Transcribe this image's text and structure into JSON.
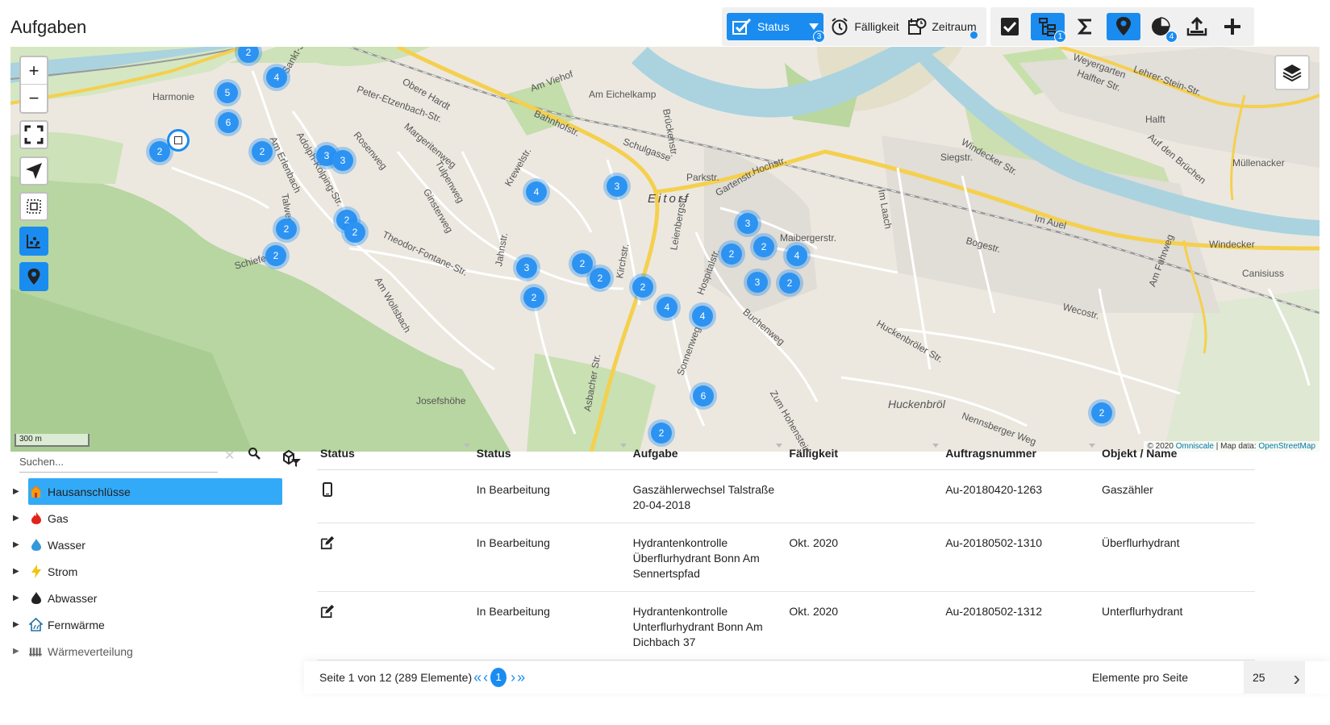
{
  "title": "Aufgaben",
  "toolbar": {
    "status_label": "Status",
    "status_badge": "3",
    "faelligkeit_label": "Fälligkeit",
    "zeitraum_label": "Zeitraum",
    "hierarchy_badge": "1",
    "chart_badge": "4"
  },
  "map": {
    "zoom_in": "+",
    "zoom_out": "−",
    "scale": "300 m",
    "attribution_prefix": "© 2020",
    "attribution_omniscale": "Omniscale",
    "attribution_sep": "| Map data:",
    "attribution_osm": "OpenStreetMap",
    "clusters": [
      "2",
      "5",
      "4",
      "6",
      "2",
      "2",
      "3",
      "3",
      "4",
      "3",
      "2",
      "2",
      "2",
      "2",
      "3",
      "2",
      "2",
      "2",
      "2",
      "4",
      "3",
      "2",
      "4",
      "2",
      "3",
      "2",
      "4",
      "6",
      "2",
      "2"
    ],
    "labels": [
      "Harmonie",
      "Eitorf",
      "Huckenbröl",
      "Josefshöhe",
      "Bahnhofstr.",
      "Siegstr.",
      "Windecker Str.",
      "Hochstr.",
      "Im Auel",
      "Bogestr.",
      "Wecostr.",
      "Am Wollsbach",
      "Theodor-Fontane-Str.",
      "Tulpenweg",
      "Ginsterweg",
      "Am Erlenbach",
      "Talweg",
      "Jahnstr.",
      "Kirchstr.",
      "Buchenweg",
      "Sonnenweg",
      "Asbacher Str.",
      "Halfter Str.",
      "Lehrer-Stein-Str.",
      "Müllenacker",
      "Canisiuss",
      "Am Viehof",
      "Am Eichelkamp",
      "Parkstr.",
      "Gartenstr.",
      "Maibergerstr.",
      "Im Laach",
      "Hospitalstr.",
      "Nennsberger Weg",
      "Zum Hohenstein",
      "Peter-Etzenbach-Str.",
      "Obere Hardt",
      "Rosenweg",
      "Margeritenweg",
      "Schiefen",
      "Krewelstr.",
      "Brückenstr.",
      "Windecker",
      "Weyergarten",
      "Halft",
      "Auf den Brüchen",
      "Schulgasse",
      "Am Fuhrweg",
      "Huckenbröler Str.",
      "Leienbergstr.",
      "Sankt-Josef-Str.",
      "Adolph-Kolping-Str."
    ]
  },
  "search": {
    "placeholder": "Suchen..."
  },
  "tree": [
    {
      "label": "Hausanschlüsse",
      "icon": "house-icon"
    },
    {
      "label": "Gas",
      "icon": "flame-icon"
    },
    {
      "label": "Wasser",
      "icon": "water-drop-icon"
    },
    {
      "label": "Strom",
      "icon": "lightning-icon"
    },
    {
      "label": "Abwasser",
      "icon": "sewage-drop-icon"
    },
    {
      "label": "Fernwärme",
      "icon": "district-heating-icon"
    },
    {
      "label": "Wärmeverteilung",
      "icon": "radiator-icon"
    }
  ],
  "table": {
    "headers": [
      "Status",
      "Status",
      "Aufgabe",
      "Fälligkeit",
      "Auftragsnummer",
      "Objekt / Name"
    ],
    "rows": [
      {
        "icon": "mobile-icon",
        "status": "In Bearbeitung",
        "task_l1": "Gaszählerwechsel Talstraße",
        "task_l2": "20-04-2018",
        "task_l3": "",
        "due": "",
        "order": "Au-20180420-1263",
        "object": "Gaszähler"
      },
      {
        "icon": "edit-icon",
        "status": "In Bearbeitung",
        "task_l1": "Hydrantenkontrolle",
        "task_l2": "Überflurhydrant Bonn Am",
        "task_l3": "Sennertspfad",
        "due": "Okt. 2020",
        "order": "Au-20180502-1310",
        "object": "Überflurhydrant"
      },
      {
        "icon": "edit-icon",
        "status": "In Bearbeitung",
        "task_l1": "Hydrantenkontrolle",
        "task_l2": "Unterflurhydrant Bonn Am",
        "task_l3": "Dichbach 37",
        "due": "Okt. 2020",
        "order": "Au-20180502-1312",
        "object": "Unterflurhydrant"
      }
    ]
  },
  "footer": {
    "page_info": "Seite 1 von 12 (289 Elemente)",
    "current_page": "1",
    "per_page_label": "Elemente pro Seite",
    "per_page_value": "25"
  },
  "colors": {
    "accent": "#1a8cf0",
    "selected_tree": "#33aaf8",
    "cluster": "#2c93f2"
  }
}
